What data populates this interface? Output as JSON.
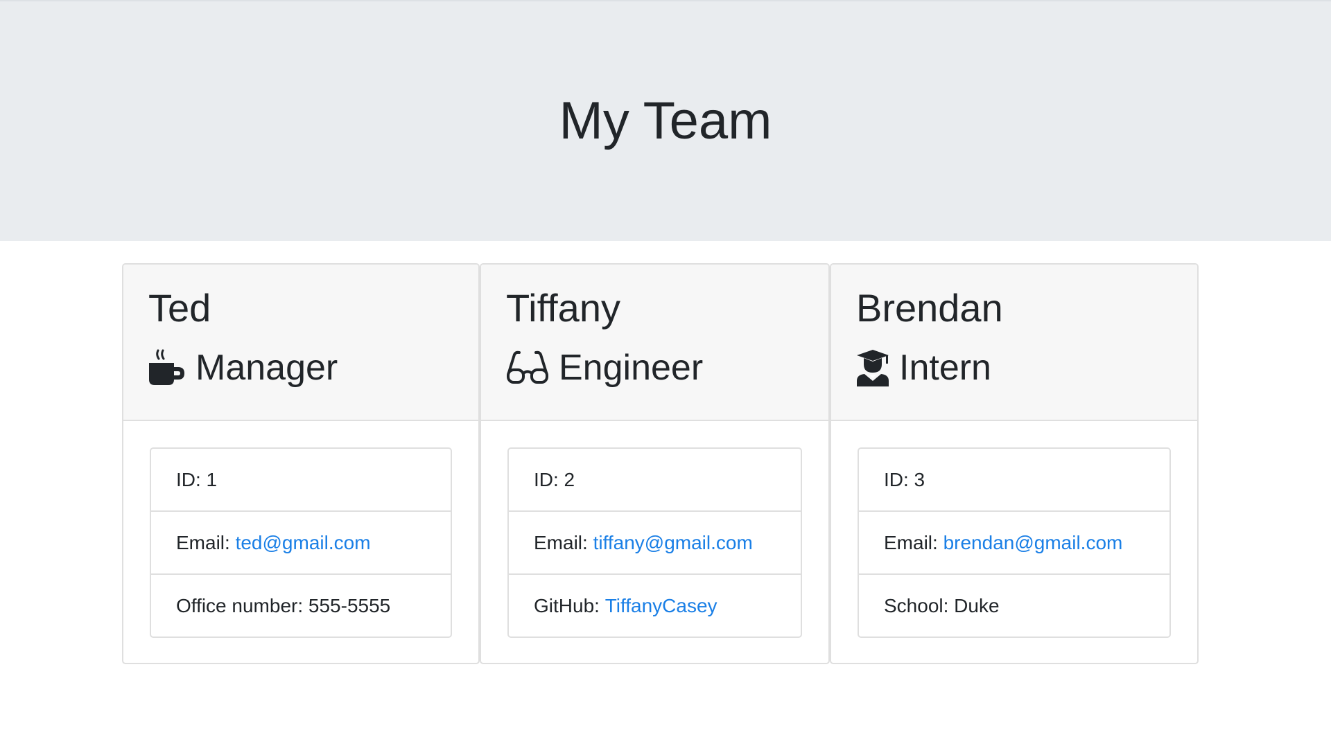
{
  "header": {
    "title": "My Team"
  },
  "colors": {
    "link": "#1a7fe6",
    "jumbotron_bg": "#e9ecef",
    "card_header_bg": "#f7f7f7"
  },
  "team": [
    {
      "name": "Ted",
      "role": "Manager",
      "role_icon": "mug-icon",
      "id_label": "ID: 1",
      "email_label": "Email: ",
      "email": "ted@gmail.com",
      "extra_label": "Office number: 555-5555",
      "extra_link": ""
    },
    {
      "name": "Tiffany",
      "role": "Engineer",
      "role_icon": "glasses-icon",
      "id_label": "ID: 2",
      "email_label": "Email: ",
      "email": "tiffany@gmail.com",
      "extra_label": "GitHub: ",
      "extra_link": "TiffanyCasey"
    },
    {
      "name": "Brendan",
      "role": "Intern",
      "role_icon": "graduate-icon",
      "id_label": "ID: 3",
      "email_label": "Email: ",
      "email": "brendan@gmail.com",
      "extra_label": "School: Duke",
      "extra_link": ""
    }
  ]
}
